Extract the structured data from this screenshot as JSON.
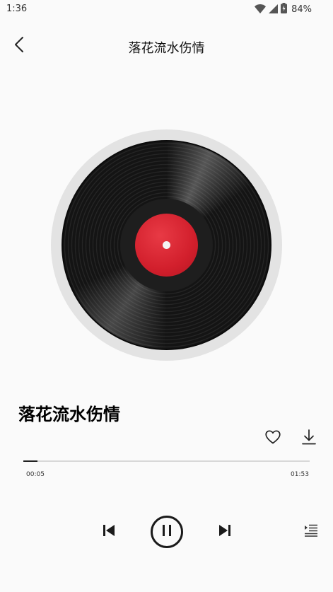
{
  "status_bar": {
    "time": "1:36",
    "battery_percent": "84%",
    "icons": [
      "wifi-icon",
      "signal-icon",
      "battery-charging-icon"
    ]
  },
  "header": {
    "back_icon": "chevron-left-icon",
    "title": "落花流水伤情"
  },
  "record": {
    "label_color": "#d21f2c"
  },
  "song": {
    "title": "落花流水伤情",
    "like_icon": "heart-outline-icon",
    "download_icon": "download-icon"
  },
  "progress": {
    "current_time": "00:05",
    "total_time": "01:53",
    "fraction": 0.05
  },
  "controls": {
    "prev_icon": "skip-previous-icon",
    "play_state": "playing",
    "pause_icon": "pause-icon",
    "next_icon": "skip-next-icon",
    "playlist_icon": "playlist-icon"
  },
  "colors": {
    "background": "#fafafa",
    "accent": "#d21f2c",
    "text": "#111111"
  }
}
